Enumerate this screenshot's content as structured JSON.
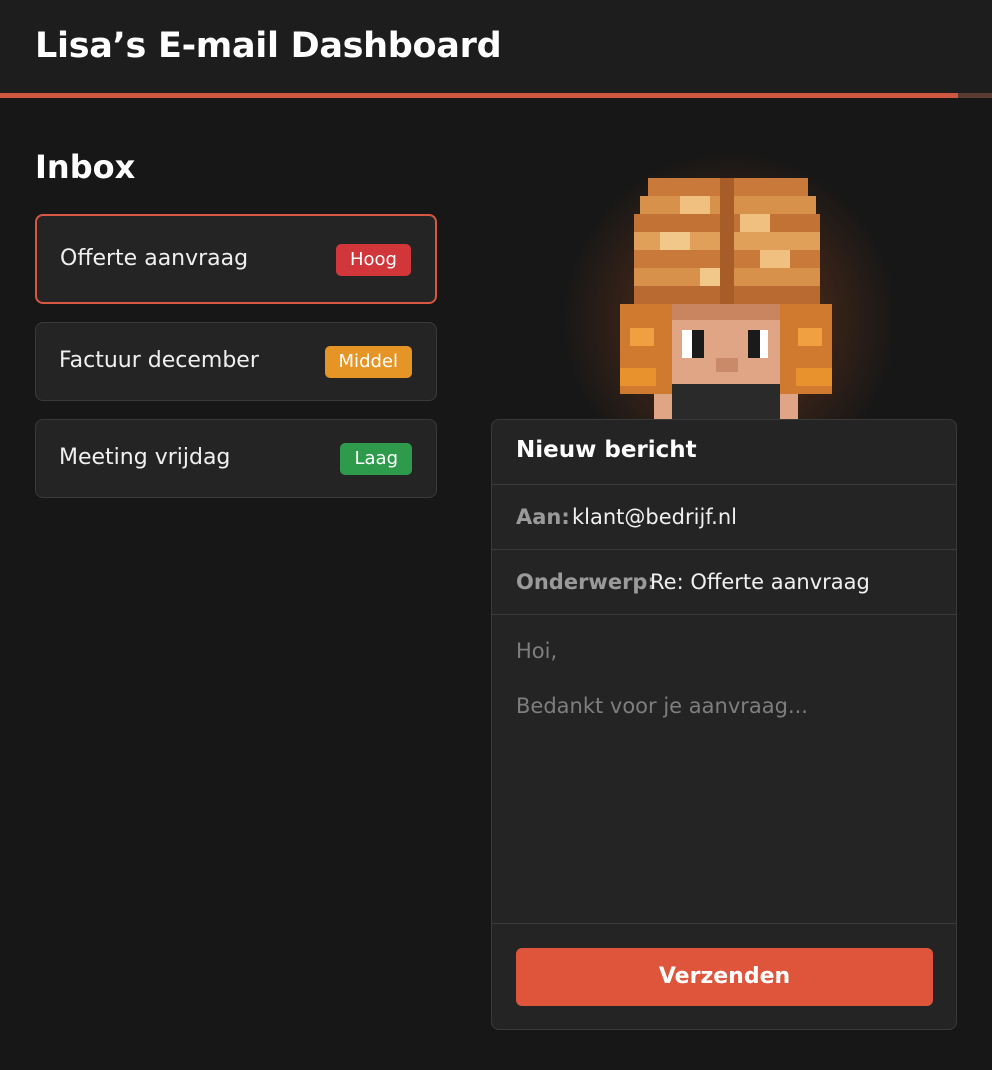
{
  "header": {
    "title": "Lisa’s E-mail Dashboard"
  },
  "inbox": {
    "title": "Inbox",
    "emails": [
      {
        "subject": "Offerte aanvraag",
        "priority": "Hoog",
        "priority_color": "#d0363a",
        "selected": true
      },
      {
        "subject": "Factuur december",
        "priority": "Middel",
        "priority_color": "#e59526",
        "selected": false
      },
      {
        "subject": "Meeting vrijdag",
        "priority": "Laag",
        "priority_color": "#2e9a4c",
        "selected": false
      }
    ]
  },
  "avatar": {
    "icon": "pixel-avatar-icon"
  },
  "compose": {
    "title": "Nieuw bericht",
    "to_label": "Aan:",
    "to_value": "klant@bedrijf.nl",
    "subject_label": "Onderwerp:",
    "subject_value": "Re: Offerte aanvraag",
    "body_lines": [
      "Hoi,",
      "Bedankt voor je aanvraag..."
    ],
    "send_label": "Verzenden"
  },
  "colors": {
    "accent": "#de553b",
    "background": "#171717",
    "panel": "#242424"
  }
}
